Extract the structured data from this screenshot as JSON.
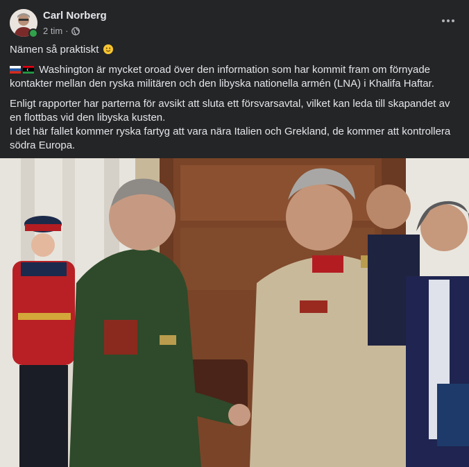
{
  "post": {
    "author": "Carl Norberg",
    "time": "2 tim",
    "separator": "·",
    "audience_icon": "globe-icon",
    "more_icon": "more-horizontal-icon",
    "paragraphs": {
      "p1": "Nämen så praktiskt",
      "p2_flags": [
        "russia-flag",
        "libya-flag"
      ],
      "p2": "Washington är mycket oroad över den information som har kommit fram om förnyade kontakter mellan den ryska militären och den libyska nationella armén (LNA) i Khalifa Haftar.",
      "p3a": "Enligt rapporter har parterna för avsikt att sluta ett försvarsavtal, vilket kan leda till skapandet av en flottbas vid den libyska kusten.",
      "p3b": "I det här fallet kommer ryska fartyg att vara nära Italien och Grekland, de kommer att kontrollera södra Europa."
    },
    "emoji": "slightly-smiling-face",
    "photo_alt": "two military officers shaking hands"
  },
  "colors": {
    "background": "#242526",
    "text": "#e4e6eb",
    "secondary_text": "#b0b3b8",
    "online": "#31a24c"
  }
}
